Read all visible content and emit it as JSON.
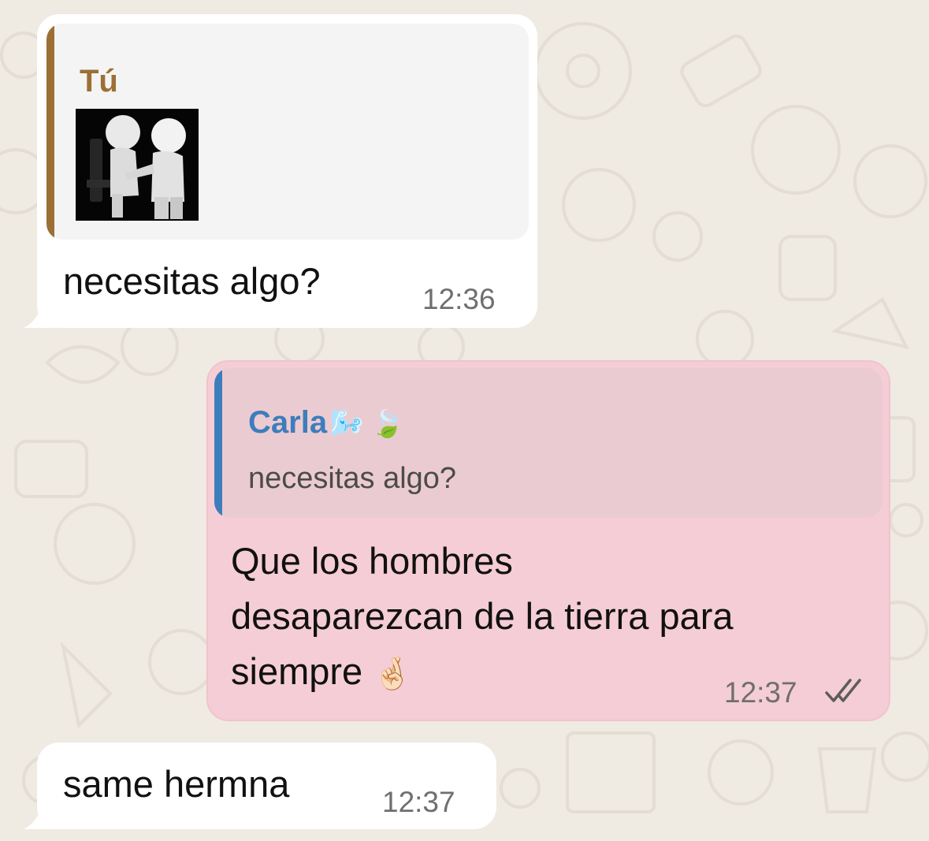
{
  "messages": [
    {
      "quote": {
        "author": "Tú",
        "thumbnail_icon": "two-figures-consoling-image"
      },
      "text": "necesitas algo?",
      "time": "12:36"
    },
    {
      "quote": {
        "author": "Carla",
        "author_emoji": "🌬️ 🍃",
        "text": "necesitas algo?"
      },
      "text_line1": "Que los hombres",
      "text_line2": "desaparezcan de la tierra para",
      "text_line3": "siempre",
      "text_emoji": "🤞🏻",
      "time": "12:37",
      "status_icon": "double-check-icon"
    },
    {
      "text": "same hermna",
      "time": "12:37"
    }
  ],
  "colors": {
    "chat_background": "#efeae2",
    "incoming_bubble": "#ffffff",
    "outgoing_bubble": "#f5cdd6",
    "quote_bar_you": "#9c6f35",
    "quote_bar_carla": "#3e7dbb",
    "author_you": "#9c6f35",
    "author_carla": "#3e7dbb"
  }
}
